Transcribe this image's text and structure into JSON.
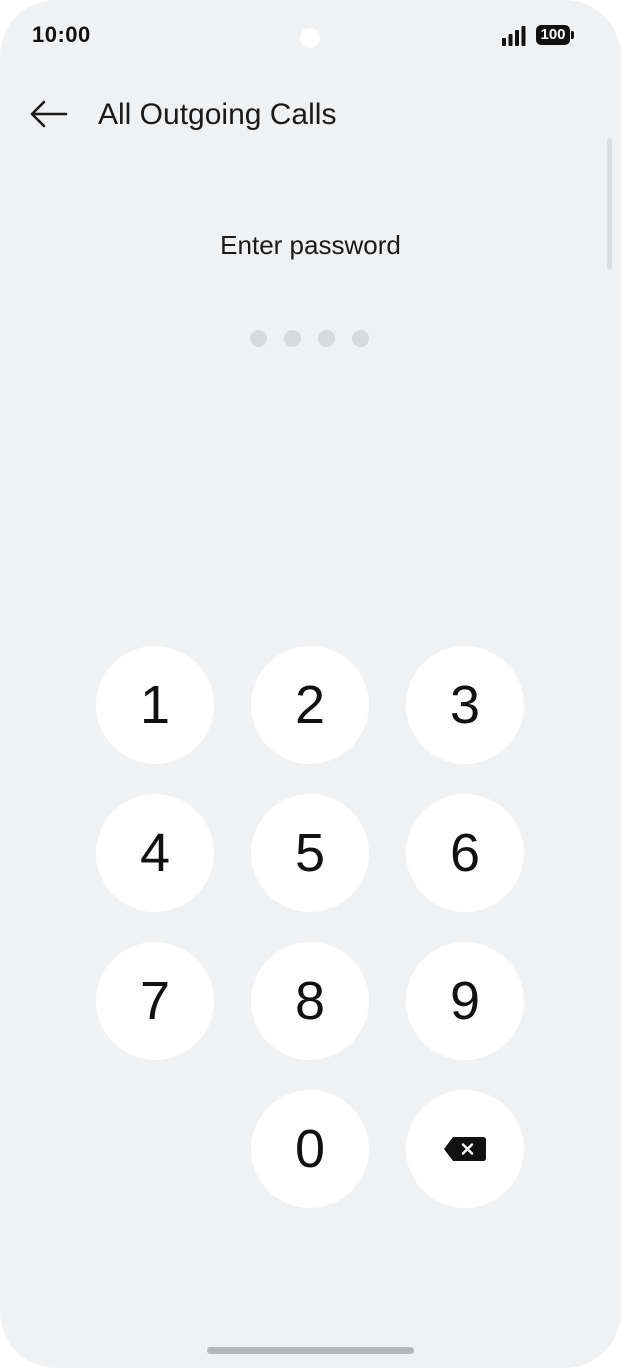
{
  "status_bar": {
    "time": "10:00",
    "battery": "100"
  },
  "header": {
    "title": "All Outgoing Calls",
    "back_icon": "arrow-left-icon"
  },
  "password": {
    "prompt": "Enter password",
    "length": 4,
    "entered": 0
  },
  "keypad": {
    "keys": [
      "1",
      "2",
      "3",
      "4",
      "5",
      "6",
      "7",
      "8",
      "9",
      "0"
    ],
    "delete_icon": "backspace-icon"
  },
  "colors": {
    "background": "#f0f1f3",
    "key": "#ffffff",
    "dot_empty": "#d8d9dc",
    "text": "#111111"
  }
}
